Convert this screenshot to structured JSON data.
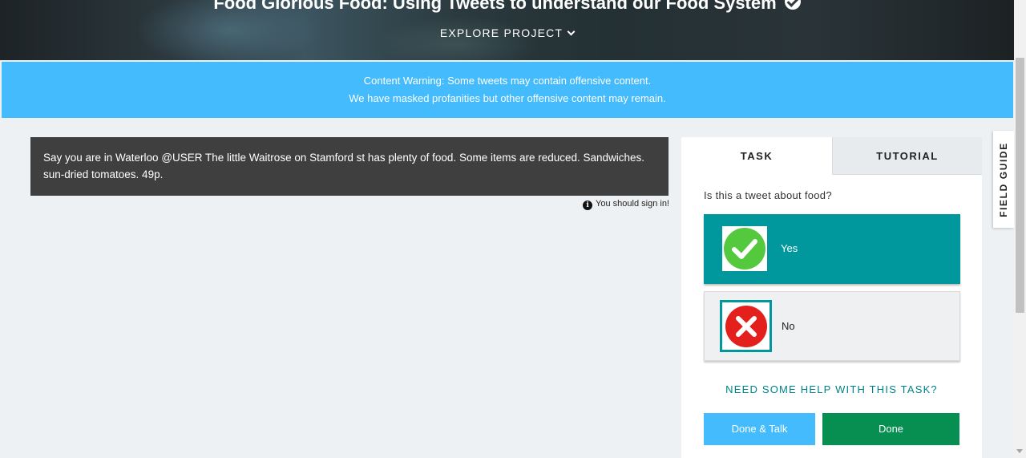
{
  "hero": {
    "title": "Food Glorious Food: Using Tweets to understand our Food System",
    "explore_label": "EXPLORE PROJECT"
  },
  "warning": {
    "line1": "Content Warning: Some tweets may contain offensive content.",
    "line2": "We have masked profanities but other offensive content may remain."
  },
  "subject": {
    "tweet_text": "Say you are in Waterloo @USER The little Waitrose on Stamford st has plenty of food. Some items are reduced. Sandwiches. sun-dried tomatoes. 49p.",
    "signin_notice": "You should sign in!"
  },
  "task_panel": {
    "tabs": [
      {
        "label": "TASK"
      },
      {
        "label": "TUTORIAL"
      }
    ],
    "question": "Is this a tweet about food?",
    "answers": [
      {
        "label": "Yes",
        "icon": "green-check-icon"
      },
      {
        "label": "No",
        "icon": "red-x-icon"
      }
    ],
    "help_link": "NEED SOME HELP WITH THIS TASK?",
    "done_talk_label": "Done & Talk",
    "done_label": "Done"
  },
  "field_guide": {
    "label": "FIELD GUIDE"
  },
  "colors": {
    "warning_bg": "#43bbfd",
    "teal": "#00979d",
    "done_green": "#078f52",
    "tweet_bg": "#3f3f3f"
  }
}
